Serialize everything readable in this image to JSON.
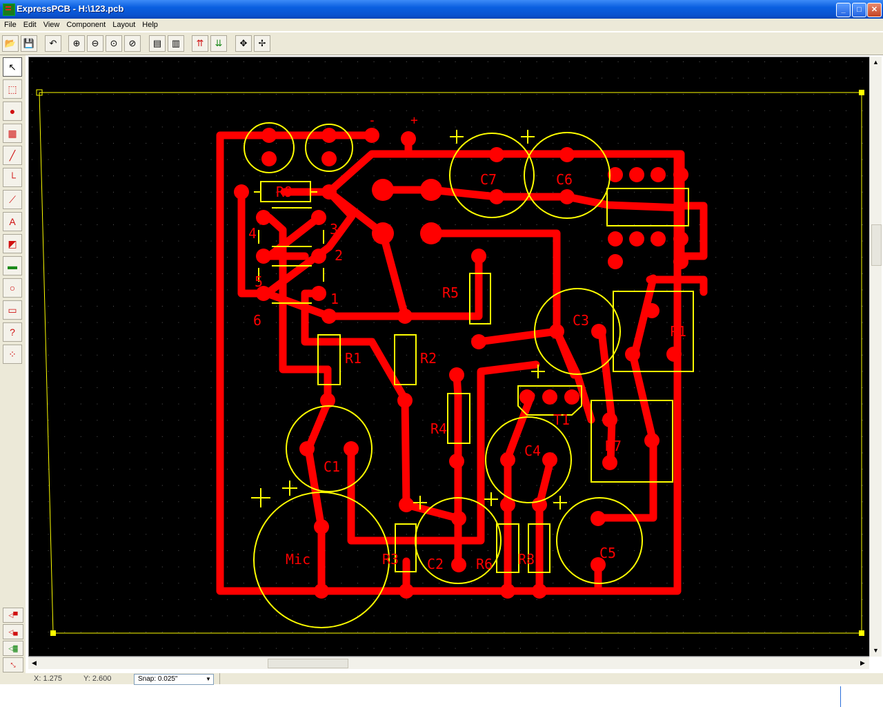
{
  "window": {
    "title": "ExpressPCB - H:\\123.pcb",
    "minimize": "_",
    "maximize": "□",
    "close": "✕"
  },
  "menu": [
    "File",
    "Edit",
    "View",
    "Component",
    "Layout",
    "Help"
  ],
  "toolbar": [
    {
      "name": "open-icon",
      "glyph": "📂"
    },
    {
      "name": "save-icon",
      "glyph": "💾"
    },
    {
      "name": "undo-icon",
      "glyph": "↶"
    },
    {
      "name": "zoom-in-icon",
      "glyph": "⊕"
    },
    {
      "name": "zoom-out-icon",
      "glyph": "⊖"
    },
    {
      "name": "zoom-fit-icon",
      "glyph": "⊙"
    },
    {
      "name": "zoom-previous-icon",
      "glyph": "⊘"
    },
    {
      "name": "properties-icon",
      "glyph": "▤"
    },
    {
      "name": "component-properties-icon",
      "glyph": "▥"
    },
    {
      "name": "move-to-top-icon",
      "glyph": "⇈"
    },
    {
      "name": "move-to-bottom-icon",
      "glyph": "⇊"
    },
    {
      "name": "center-icon",
      "glyph": "✥"
    },
    {
      "name": "center-all-icon",
      "glyph": "✢"
    }
  ],
  "tools": [
    {
      "name": "select-tool-icon",
      "glyph": "↖"
    },
    {
      "name": "zoom-window-tool-icon",
      "glyph": "⬚"
    },
    {
      "name": "pad-tool-icon",
      "glyph": "●"
    },
    {
      "name": "component-tool-icon",
      "glyph": "▦"
    },
    {
      "name": "trace-tool-icon",
      "glyph": "╱"
    },
    {
      "name": "corner-tool-icon",
      "glyph": "└"
    },
    {
      "name": "line-tool-icon",
      "glyph": "⟋"
    },
    {
      "name": "text-tool-icon",
      "glyph": "A"
    },
    {
      "name": "fill-tool-icon",
      "glyph": "◩"
    },
    {
      "name": "module-tool-icon",
      "glyph": "▬"
    },
    {
      "name": "circle-tool-icon",
      "glyph": "○"
    },
    {
      "name": "rectangle-tool-icon",
      "glyph": "▭"
    },
    {
      "name": "pad-properties-tool-icon",
      "glyph": "?"
    },
    {
      "name": "netlist-tool-icon",
      "glyph": "⁘"
    }
  ],
  "layers": [
    {
      "name": "layer-top-icon",
      "glyph": "◁▀"
    },
    {
      "name": "layer-bottom-icon",
      "glyph": "◁▄"
    },
    {
      "name": "layer-both-icon",
      "glyph": "◁▓"
    },
    {
      "name": "layer-connect-icon",
      "glyph": "⤡"
    }
  ],
  "status": {
    "x": "X: 1.275",
    "y": "Y: 2.600",
    "snap": "Snap:  0.025\""
  },
  "pcb": {
    "labels": [
      "R9",
      "4",
      "3",
      "2",
      "5",
      "1",
      "6",
      "C7",
      "C6",
      "R5",
      "C3",
      "P1",
      "R1",
      "R2",
      "C1",
      "R4",
      "C4",
      "T1",
      "R7",
      "Mic",
      "R3",
      "C2",
      "R6",
      "R8",
      "C5",
      "-",
      "+"
    ],
    "colors": {
      "trace": "#ff0000",
      "silk": "#ffff00",
      "board": "#000000"
    }
  }
}
